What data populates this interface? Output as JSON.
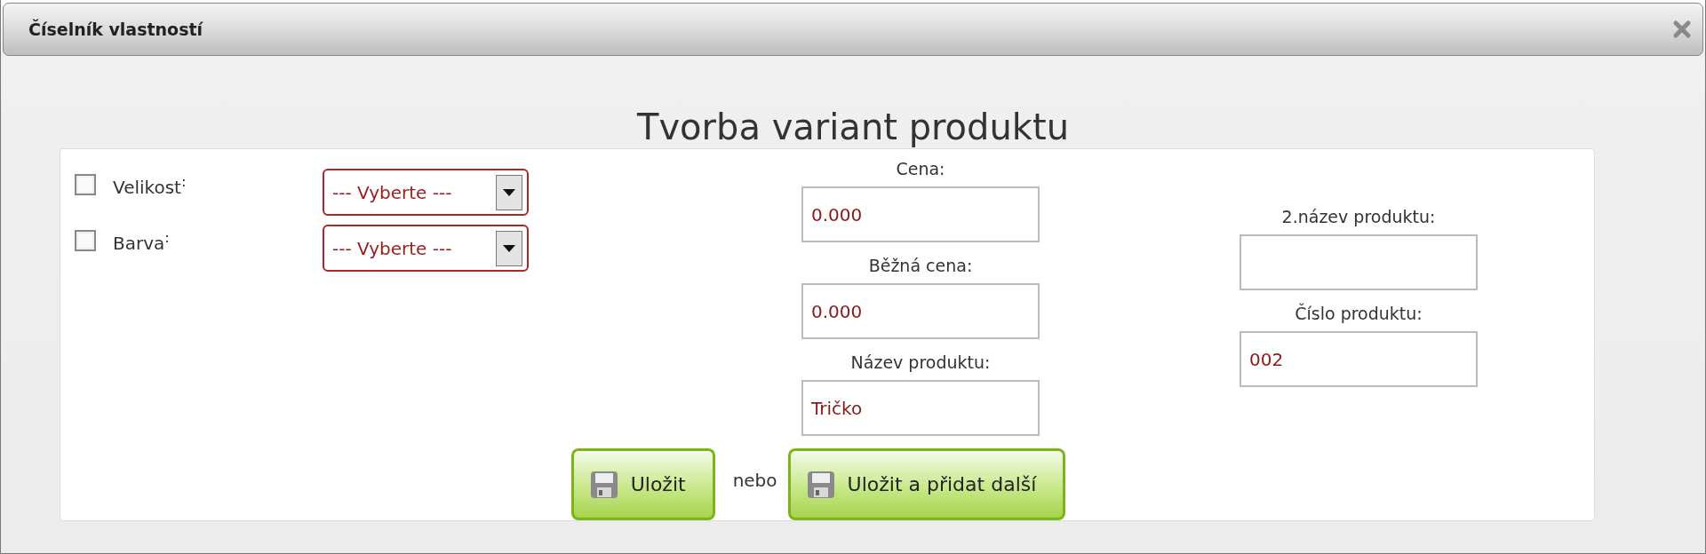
{
  "window": {
    "title": "Číselník vlastností"
  },
  "heading": "Tvorba variant produktu",
  "properties": [
    {
      "label": "Velikost$^{:}$",
      "checked": false,
      "select": "--- Vyberte ---"
    },
    {
      "label": "Barva$^{:}$",
      "checked": false,
      "select": "--- Vyberte ---"
    }
  ],
  "fields_center": [
    {
      "label": "Cena:",
      "value": "0.000"
    },
    {
      "label": "Běžná cena:",
      "value": "0.000"
    },
    {
      "label": "Název produktu:",
      "value": "Tričko"
    }
  ],
  "fields_right": [
    {
      "label": "2.název produktu:"
    },
    {
      "label": "Číslo produktu:",
      "value": "002"
    }
  ],
  "buttons": [
    {
      "label": "Uložit"
    },
    {
      "label": "Uložit a přidat další"
    }
  ],
  "separator": "nebo"
}
